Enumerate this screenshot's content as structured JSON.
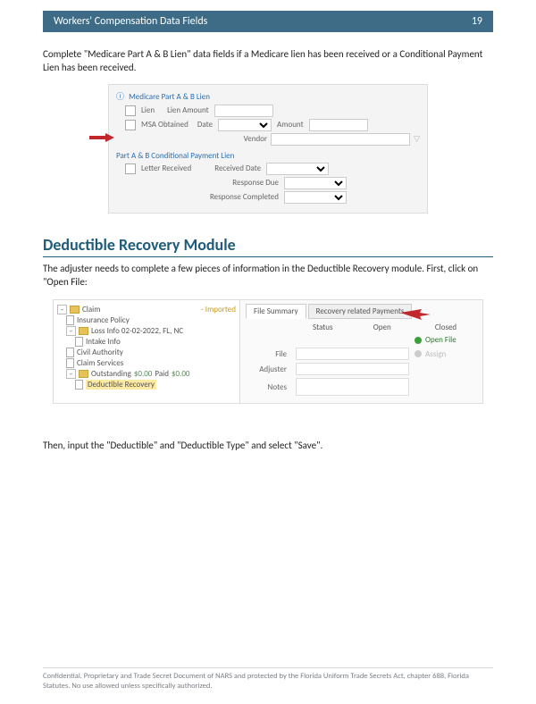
{
  "header": {
    "title": "Workers' Compensation Data Fields",
    "page": "19"
  },
  "para1": "Complete \"Medicare Part A & B Lien\" data fields if a Medicare lien has been received or a Conditional Payment Lien has been received.",
  "medicare_panel": {
    "group_title": "Medicare Part A & B Lien",
    "lien_chk": "Lien",
    "lien_amount_lbl": "Lien Amount",
    "msa_chk": "MSA Obtained",
    "date_lbl": "Date",
    "amount_lbl": "Amount",
    "vendor_lbl": "Vendor",
    "subheader": "Part A & B Conditional Payment Lien",
    "letter_chk": "Letter Received",
    "received_date_lbl": "Received Date",
    "response_due_lbl": "Response Due",
    "response_completed_lbl": "Response Completed"
  },
  "section_title": "Deductible Recovery Module",
  "para2": "The adjuster needs to complete a few pieces of information in the Deductible Recovery module.  First, click on \"Open File:",
  "tree": {
    "claim_label": "Claim",
    "claim_status": "- Imported",
    "insurance_policy": "Insurance Policy",
    "loss_info": "Loss Info 02-02-2022, FL, NC",
    "intake_info": "Intake Info",
    "civil_authority": "Civil Authority",
    "claim_services": "Claim Services",
    "outstanding": "Outstanding",
    "outstanding_amt": "$0.00",
    "paid_lbl": "Paid",
    "paid_amt": "$0.00",
    "deductible_recovery": "Deductible Recovery"
  },
  "detail": {
    "tab1": "File Summary",
    "tab2": "Recovery related Payments",
    "col_status": "Status",
    "col_open": "Open",
    "col_closed": "Closed",
    "row_file": "File",
    "row_adjuster": "Adjuster",
    "row_notes": "Notes",
    "open_file": "Open File",
    "assign": "Assign"
  },
  "para3": "Then, input the \"Deductible\" and \"Deductible Type\" and select \"Save\".",
  "footer": "Confidential, Proprietary and Trade Secret Document of NARS and protected by the Florida Uniform Trade Secrets Act, chapter 688, Florida Statutes. No use allowed unless specifically authorized."
}
